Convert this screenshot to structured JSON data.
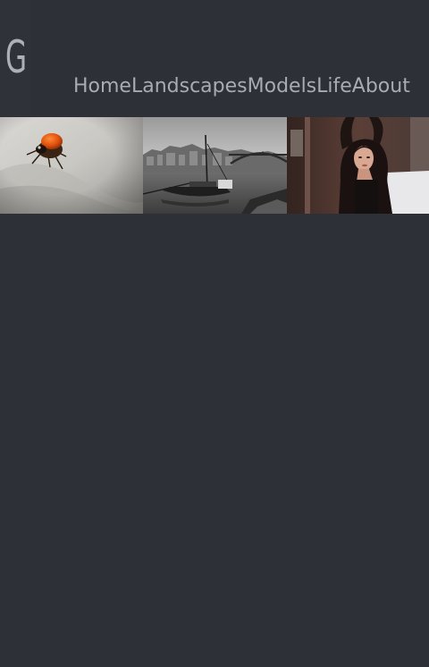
{
  "site": {
    "logo_letter": "G"
  },
  "nav": {
    "items": [
      {
        "label": "Home"
      },
      {
        "label": "Landscapes"
      },
      {
        "label": "Models"
      },
      {
        "label": "Life"
      },
      {
        "label": "About"
      }
    ]
  },
  "gallery": {
    "photos": [
      {
        "subject": "ladybug-macro"
      },
      {
        "subject": "porto-river-boat-bridge"
      },
      {
        "subject": "woman-portrait"
      }
    ]
  },
  "colors": {
    "background": "#2e3038",
    "nav_text": "#a9abb1",
    "logo_text": "#aeb0b5"
  }
}
